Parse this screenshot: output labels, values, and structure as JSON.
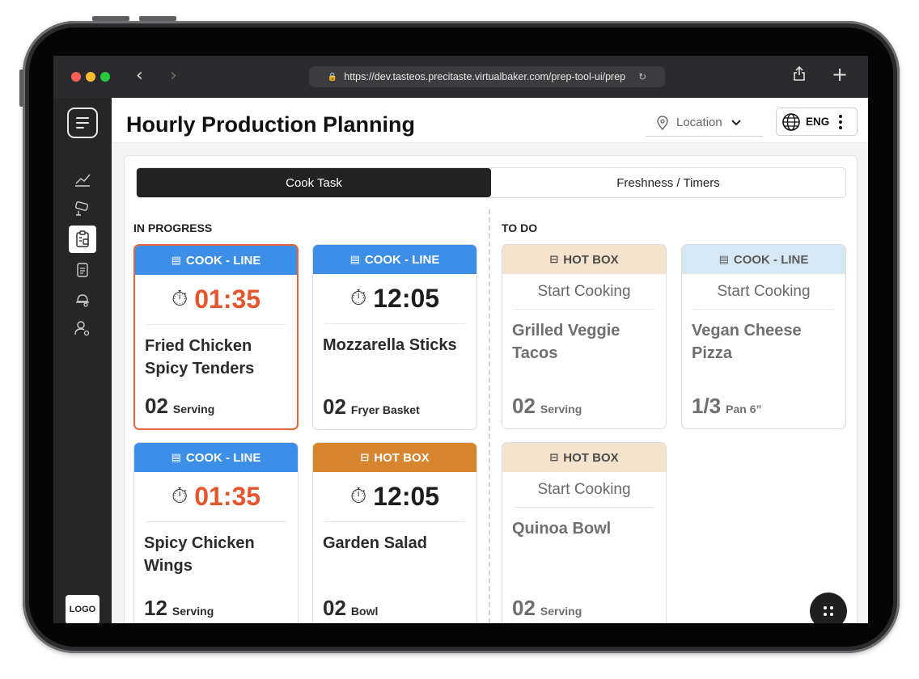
{
  "browser": {
    "url": "https://dev.tasteos.precitaste.virtualbaker.com/prep-tool-ui/prep",
    "back_icon": "chevron-left-icon",
    "forward_icon": "chevron-right-icon",
    "share_icon": "share-icon",
    "new_tab_icon": "plus-icon"
  },
  "sidebar": {
    "menu_icon": "menu-icon",
    "items": [
      {
        "icon": "chart-icon"
      },
      {
        "icon": "camera-icon"
      },
      {
        "icon": "clipboard-icon",
        "active": true
      },
      {
        "icon": "document-icon"
      },
      {
        "icon": "bell-icon"
      },
      {
        "icon": "user-settings-icon"
      }
    ],
    "logo": "LOGO"
  },
  "header": {
    "title": "Hourly Production Planning",
    "location_placeholder": "Location",
    "language": "ENG"
  },
  "tabs": [
    {
      "label": "Cook Task",
      "active": true
    },
    {
      "label": "Freshness / Timers",
      "active": false
    }
  ],
  "in_progress": {
    "label": "IN PROGRESS",
    "cards": [
      {
        "station": "COOK - LINE",
        "timer": "01:35",
        "name": "Fried Chicken Spicy Tenders",
        "qty": "02",
        "unit": "Serving"
      },
      {
        "station": "COOK - LINE",
        "timer": "12:05",
        "name": "Mozzarella Sticks",
        "qty": "02",
        "unit": "Fryer Basket"
      },
      {
        "station": "COOK - LINE",
        "timer": "01:35",
        "name": "Spicy Chicken Wings",
        "qty": "12",
        "unit": "Serving"
      },
      {
        "station": "HOT BOX",
        "timer": "12:05",
        "name": "Garden Salad",
        "qty": "02",
        "unit": "Bowl"
      }
    ]
  },
  "todo": {
    "label": "TO DO",
    "cards": [
      {
        "station": "HOT BOX",
        "action": "Start Cooking",
        "name": "Grilled Veggie Tacos",
        "qty": "02",
        "unit": "Serving"
      },
      {
        "station": "COOK - LINE",
        "action": "Start Cooking",
        "name": "Vegan Cheese Pizza",
        "qty": "1/3",
        "unit": "Pan 6”"
      },
      {
        "station": "HOT BOX",
        "action": "Start Cooking",
        "name": "Quinoa Bowl",
        "qty": "02",
        "unit": "Serving"
      }
    ]
  },
  "colors": {
    "cook_line": "#3d8ee6",
    "hot_box": "#d88530",
    "todo_hot_box": "#f6e3cd",
    "todo_cook_line": "#d7e8f5",
    "alert": "#e4572e"
  }
}
